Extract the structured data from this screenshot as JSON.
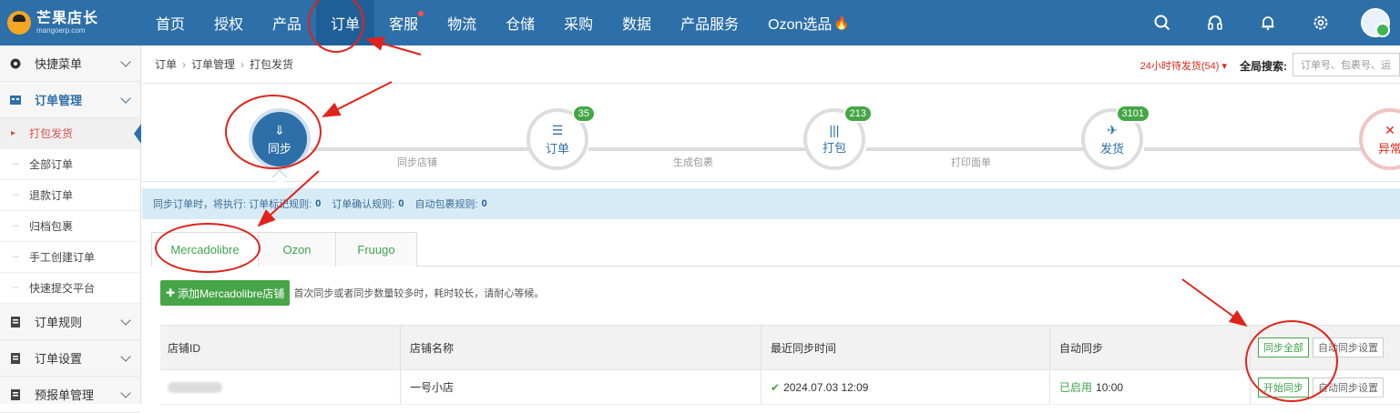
{
  "logo": {
    "cn": "芒果店长",
    "en": "mangoerp.com"
  },
  "nav": [
    "首页",
    "授权",
    "产品",
    "订单",
    "客服",
    "物流",
    "仓储",
    "采购",
    "数据",
    "产品服务",
    "Ozon选品"
  ],
  "sidebar": {
    "quick": "快捷菜单",
    "order_mgmt": "订单管理",
    "subs": [
      "打包发货",
      "全部订单",
      "退款订单",
      "归档包裹",
      "手工创建订单",
      "快速提交平台"
    ],
    "order_rules": "订单规则",
    "order_settings": "订单设置",
    "presale": "预报单管理"
  },
  "breadcrumb": [
    "订单",
    "订单管理",
    "打包发货"
  ],
  "pending": "24小时待发货(54)",
  "global_search": {
    "label": "全局搜索:",
    "placeholder": "订单号、包裹号、运"
  },
  "flow": {
    "steps": [
      {
        "label": "同步",
        "icon": "⇓"
      },
      {
        "label": "订单",
        "icon": "☰",
        "badge": "35"
      },
      {
        "label": "打包",
        "icon": "|||",
        "badge": "213"
      },
      {
        "label": "发货",
        "icon": "✈",
        "badge": "3101"
      },
      {
        "label": "异常",
        "icon": "✕"
      }
    ],
    "links": [
      "同步店铺",
      "生成包裹",
      "打印面单"
    ]
  },
  "info": {
    "prefix": "同步订单时，将执行:",
    "r1": "订单标记规则:",
    "v1": "0",
    "r2": "订单确认规则:",
    "v2": "0",
    "r3": "自动包裹规则:",
    "v3": "0"
  },
  "tabs": [
    "Mercadolibre",
    "Ozon",
    "Fruugo"
  ],
  "toolbar": {
    "add": "添加Mercadolibre店铺",
    "tip": "首次同步或者同步数量较多时，耗时较长，请耐心等候。"
  },
  "table": {
    "headers": [
      "店铺ID",
      "店铺名称",
      "最近同步时间",
      "自动同步"
    ],
    "sync_all": "同步全部",
    "auto_setting": "自动同步设置",
    "rows": [
      {
        "name": "一号小店",
        "time": "2024.07.03 12:09",
        "status": "已启用",
        "at": "10:00",
        "sync": "开始同步",
        "auto": "自动同步设置"
      }
    ]
  }
}
